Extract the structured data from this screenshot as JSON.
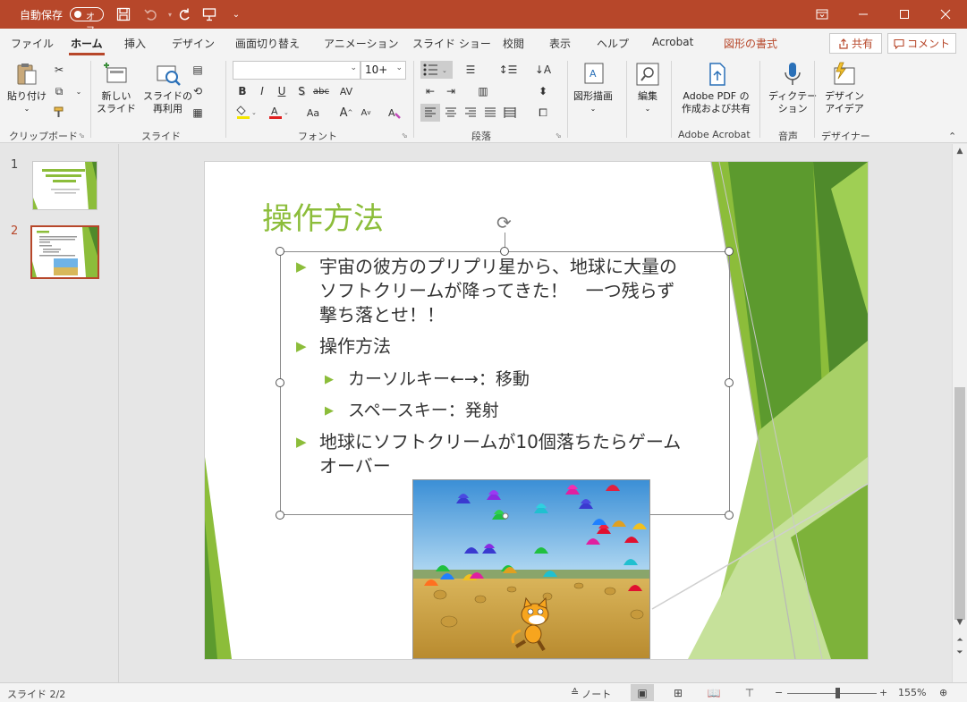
{
  "titlebar": {
    "autosave_label": "自動保存",
    "autosave_state": "オフ",
    "bg_color": "#b7472a",
    "icons": [
      "save-icon",
      "undo-icon",
      "redo-icon",
      "present-from-start-icon",
      "customize-qat-icon"
    ],
    "window_buttons": [
      "ribbon-display-icon",
      "minimize-icon",
      "maximize-icon",
      "close-icon"
    ]
  },
  "tabs": [
    {
      "label": "ファイル"
    },
    {
      "label": "ホーム"
    },
    {
      "label": "挿入"
    },
    {
      "label": "デザイン"
    },
    {
      "label": "画面切り替え"
    },
    {
      "label": "アニメーション"
    },
    {
      "label": "スライド ショー"
    },
    {
      "label": "校閲"
    },
    {
      "label": "表示"
    },
    {
      "label": "ヘルプ"
    },
    {
      "label": "Acrobat"
    },
    {
      "label": "図形の書式"
    }
  ],
  "active_tab": "ホーム",
  "share_label": "共有",
  "comment_label": "コメント",
  "ribbon": {
    "clipboard": {
      "paste_label": "貼り付け",
      "group_label": "クリップボード"
    },
    "slides": {
      "new_slide_line1": "新しい",
      "new_slide_line2": "スライド",
      "reuse_line1": "スライドの",
      "reuse_line2": "再利用",
      "group_label": "スライド"
    },
    "font": {
      "font_name": "",
      "font_size": "10+",
      "group_label": "フォント",
      "bold": "B",
      "italic": "I",
      "underline": "U",
      "shadow": "S",
      "strike": "abc",
      "spacing": "AV",
      "case": "Aa",
      "grow": "A",
      "shrink": "A",
      "clear": "A"
    },
    "paragraph": {
      "group_label": "段落"
    },
    "drawing": {
      "label": "図形描画"
    },
    "editing": {
      "label": "編集"
    },
    "adobe": {
      "line1": "Adobe PDF の",
      "line2": "作成および共有",
      "group_label": "Adobe Acrobat"
    },
    "voice": {
      "line1": "ディクテー",
      "line2": "ション",
      "group_label": "音声"
    },
    "designer": {
      "line1": "デザイン",
      "line2": "アイデア",
      "group_label": "デザイナー"
    }
  },
  "thumbnails": [
    {
      "number": "1",
      "title": "Scratchによるプログラミング"
    },
    {
      "number": "2",
      "title": "操作方法"
    }
  ],
  "slide": {
    "title": "操作方法",
    "title_color": "#8cbd3a",
    "bullets": [
      {
        "level": 1,
        "lines": [
          "宇宙の彼方のプリプリ星から、地球に大量の",
          "ソフトクリームが降ってきた！　一つ残らず",
          "撃ち落とせ！！"
        ]
      },
      {
        "level": 1,
        "lines": [
          "操作方法"
        ]
      },
      {
        "level": 2,
        "lines": [
          "カーソルキー←→：移動"
        ]
      },
      {
        "level": 2,
        "lines": [
          "スペースキー：発射"
        ]
      },
      {
        "level": 1,
        "lines": [
          "地球にソフトクリームが10個落ちたらゲーム",
          "オーバー"
        ]
      }
    ],
    "accent_green": "#8cbd3a",
    "dark_green": "#4f8a2b"
  },
  "status": {
    "slide_info": "スライド 2/2",
    "notes_label": "ノート",
    "zoom_minus": "−",
    "zoom_plus": "+",
    "zoom_level": "155%"
  }
}
